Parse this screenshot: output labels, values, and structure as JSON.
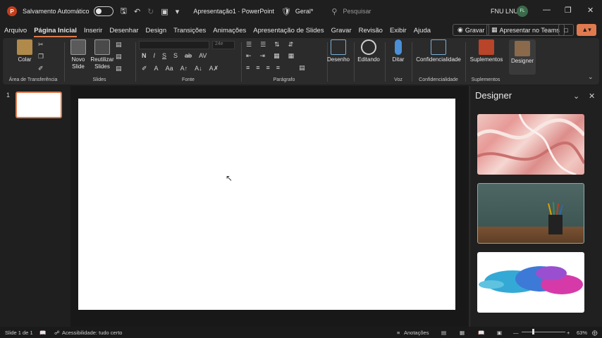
{
  "titlebar": {
    "autosave_label": "Salvamento Automático",
    "doc_title": "Apresentação1 · PowerPoint",
    "sensitivity": "Geral*",
    "search_placeholder": "Pesquisar",
    "user_name": "FNU LNU",
    "user_initials": "FL"
  },
  "tabs": [
    "Arquivo",
    "Página Inicial",
    "Inserir",
    "Desenhar",
    "Design",
    "Transições",
    "Animações",
    "Apresentação de Slides",
    "Gravar",
    "Revisão",
    "Exibir",
    "Ajuda"
  ],
  "actions": {
    "record": "Gravar",
    "present_teams": "Apresentar no Teams"
  },
  "ribbon": {
    "paste": "Colar",
    "new_slide": "Novo\nSlide",
    "new_slide_l1": "Novo",
    "new_slide_l2": "Slide",
    "reuse_l1": "Reutilizar",
    "reuse_l2": "Slides",
    "font_size": "24e",
    "drawing": "Desenho",
    "editing": "Editando",
    "dictate": "Ditar",
    "sensitivity": "Confidencialidade",
    "addins": "Suplementos",
    "designer": "Designer",
    "groups": {
      "clipboard": "Área de Transferência",
      "slides": "Slides",
      "font": "Fonte",
      "paragraph": "Parágrafo",
      "voice": "Voz",
      "sensitivity": "Confidencialidade",
      "addins": "Suplementos"
    }
  },
  "thumbnails": {
    "slide_number": "1"
  },
  "designer_pane": {
    "title": "Designer"
  },
  "statusbar": {
    "slide_info": "Slide 1 de 1",
    "accessibility": "Acessibilidade: tudo certo",
    "notes": "Anotações",
    "zoom": "63%"
  },
  "colors": {
    "accent": "#e07a4f",
    "background": "#1f1f1f",
    "ribbon": "#2b2b2b",
    "slide": "#ffffff"
  }
}
